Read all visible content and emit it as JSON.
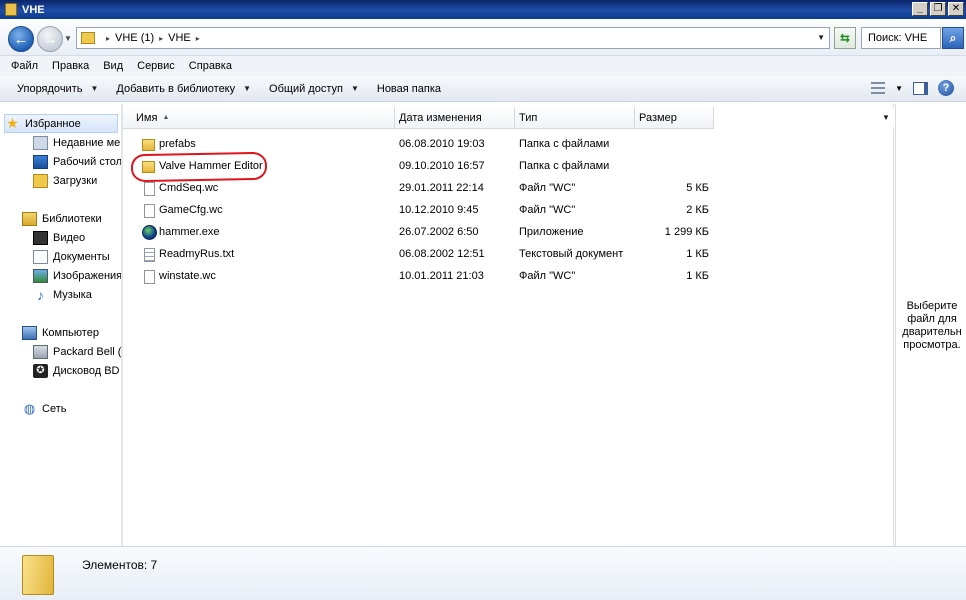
{
  "window": {
    "title": "VHE"
  },
  "address": {
    "crumbs": [
      "VHE (1)",
      "VHE"
    ],
    "search_placeholder": "Поиск: VHE"
  },
  "menu": [
    "Файл",
    "Правка",
    "Вид",
    "Сервис",
    "Справка"
  ],
  "commands": {
    "organize": "Упорядочить",
    "add_to_library": "Добавить в библиотеку",
    "share": "Общий доступ",
    "new_folder": "Новая папка"
  },
  "nav": {
    "favorites": "Избранное",
    "recent": "Недавние ме",
    "desktop": "Рабочий стол",
    "downloads": "Загрузки",
    "libraries": "Библиотеки",
    "video": "Видео",
    "documents": "Документы",
    "images": "Изображения",
    "music": "Музыка",
    "computer": "Компьютер",
    "drive_c": "Packard Bell (C",
    "drive_bd": "Дисковод BD",
    "network": "Сеть"
  },
  "columns": {
    "name": "Имя",
    "modified": "Дата изменения",
    "type": "Тип",
    "size": "Размер"
  },
  "files": [
    {
      "name": "prefabs",
      "modified": "06.08.2010 19:03",
      "type": "Папка с файлами",
      "size": "",
      "icon": "folder"
    },
    {
      "name": "Valve Hammer Editor",
      "modified": "09.10.2010 16:57",
      "type": "Папка с файлами",
      "size": "",
      "icon": "folder"
    },
    {
      "name": "CmdSeq.wc",
      "modified": "29.01.2011 22:14",
      "type": "Файл \"WC\"",
      "size": "5 КБ",
      "icon": "doc"
    },
    {
      "name": "GameCfg.wc",
      "modified": "10.12.2010 9:45",
      "type": "Файл \"WC\"",
      "size": "2 КБ",
      "icon": "doc"
    },
    {
      "name": "hammer.exe",
      "modified": "26.07.2002 6:50",
      "type": "Приложение",
      "size": "1 299 КБ",
      "icon": "exe"
    },
    {
      "name": "ReadmyRus.txt",
      "modified": "06.08.2002 12:51",
      "type": "Текстовый документ",
      "size": "1 КБ",
      "icon": "txt"
    },
    {
      "name": "winstate.wc",
      "modified": "10.01.2011 21:03",
      "type": "Файл \"WC\"",
      "size": "1 КБ",
      "icon": "doc"
    }
  ],
  "preview": {
    "text": "Выберите файл для дварительн просмотра."
  },
  "details": {
    "count": "Элементов: 7"
  },
  "colors": {
    "highlight": "#e0141c",
    "titlebar": "#0a246a"
  }
}
